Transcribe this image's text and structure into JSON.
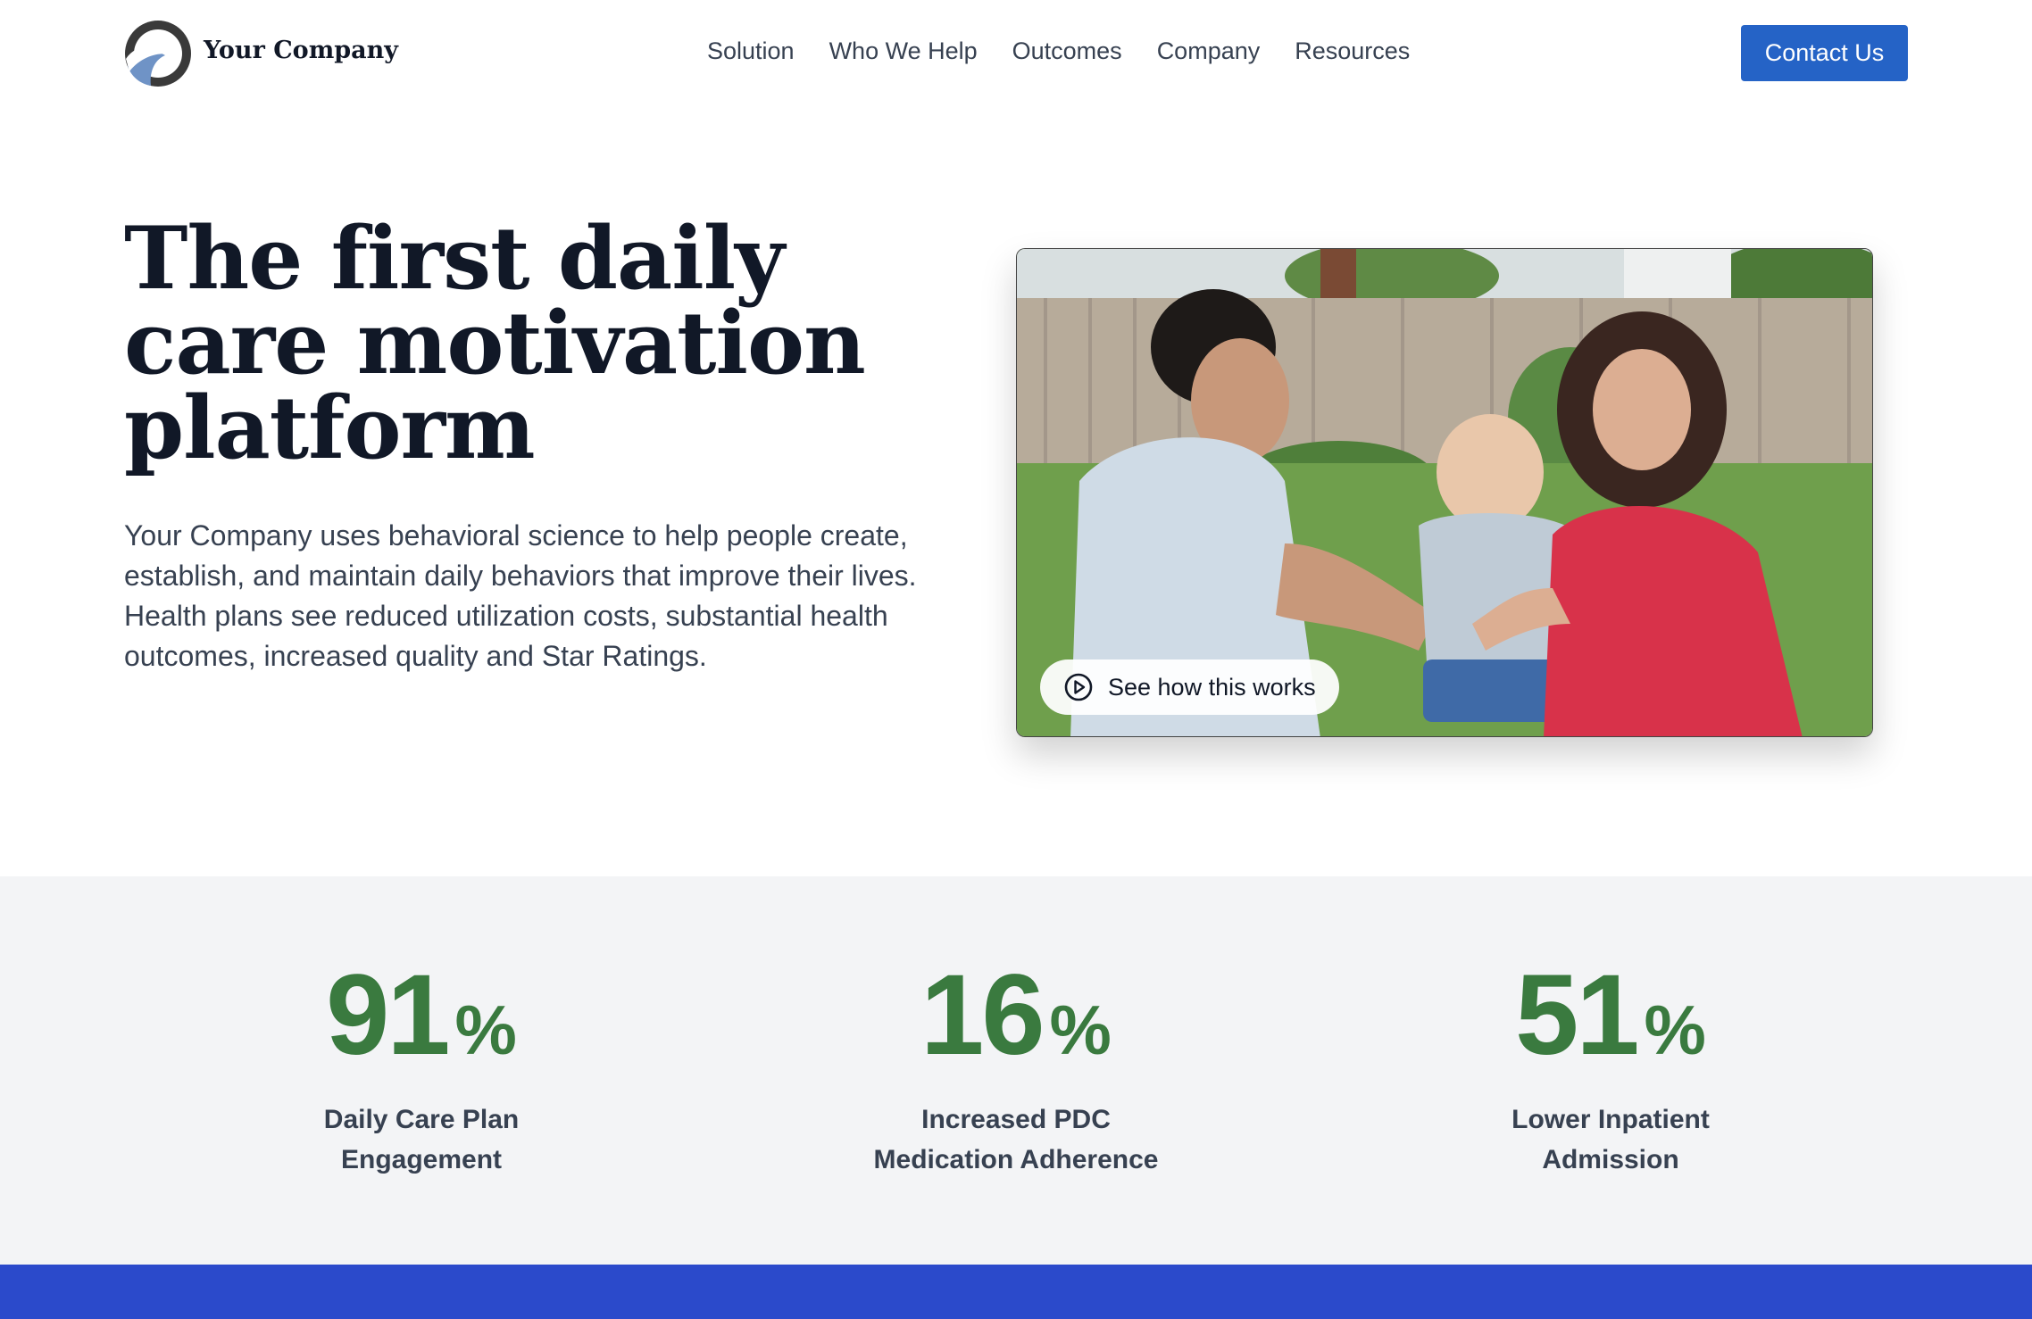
{
  "header": {
    "brand_name": "Your Company",
    "logo_icon": "company-logo-icon",
    "nav": [
      {
        "label": "Solution"
      },
      {
        "label": "Who We Help"
      },
      {
        "label": "Outcomes"
      },
      {
        "label": "Company"
      },
      {
        "label": "Resources"
      }
    ],
    "contact_label": "Contact Us"
  },
  "hero": {
    "title": "The first daily care motivation platform",
    "description": "Your Company uses behavioral science to help people create, establish, and maintain daily behaviors that improve their lives. Health plans see reduced utilization costs, substantial health outcomes, increased quality and Star Ratings.",
    "video_cta": "See how this works",
    "video_icon": "play-circle-icon",
    "image_subject": "family-photo"
  },
  "stats": [
    {
      "value": "91",
      "suffix": "%",
      "label_line1": "Daily Care Plan",
      "label_line2": "Engagement"
    },
    {
      "value": "16",
      "suffix": "%",
      "label_line1": "Increased PDC",
      "label_line2": "Medication Adherence"
    },
    {
      "value": "51",
      "suffix": "%",
      "label_line1": "Lower Inpatient",
      "label_line2": "Admission"
    }
  ],
  "colors": {
    "accent_blue": "#2563c6",
    "stat_green": "#3a7a3f",
    "band_blue": "#2b4acb",
    "stats_bg": "#f3f4f6"
  }
}
